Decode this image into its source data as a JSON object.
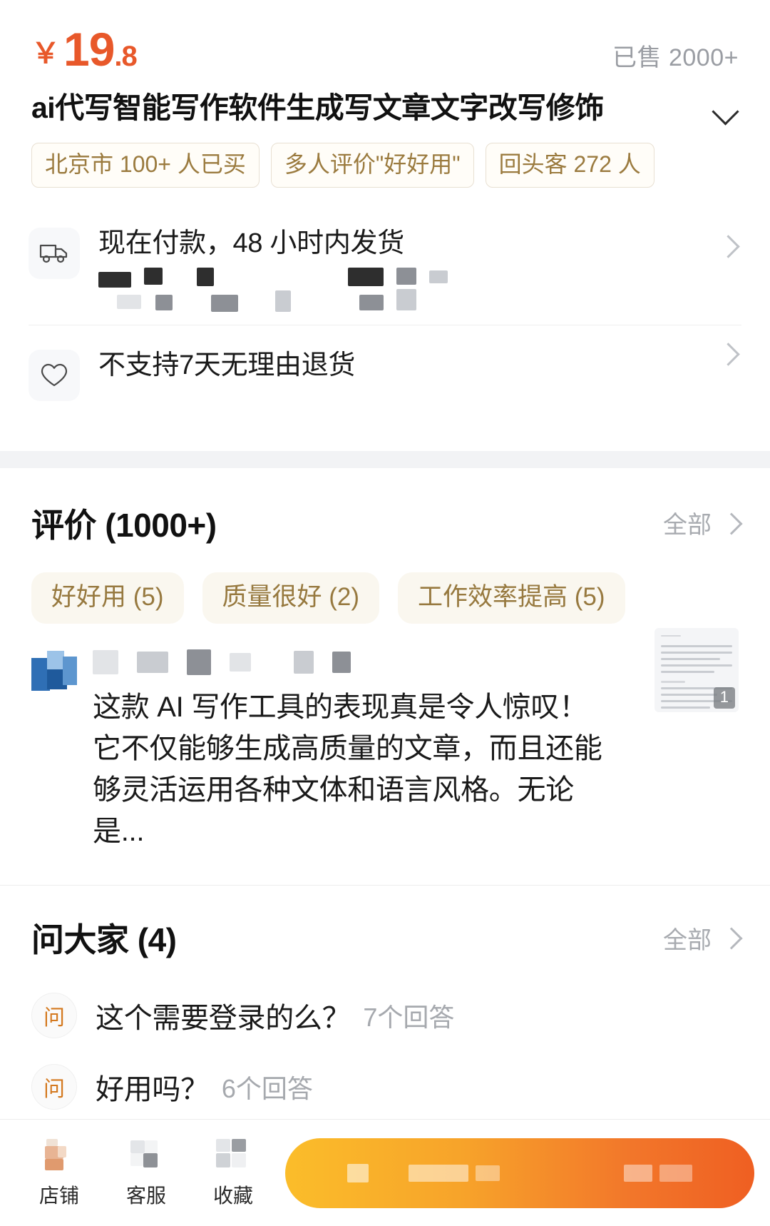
{
  "price": {
    "currency_symbol": "￥",
    "integer": "19",
    "decimal": ".8",
    "sold_label": "已售 2000+"
  },
  "product": {
    "title": "ai代写智能写作软件生成写文章文字改写修饰",
    "expand_icon": "chevron-down-icon",
    "tags": [
      "北京市 100+ 人已买",
      "多人评价\"好好用\"",
      "回头客 272 人"
    ]
  },
  "services": [
    {
      "icon": "truck-icon",
      "title": "现在付款，48 小时内发货",
      "has_redacted_sub": true,
      "chevron": "chevron-right-icon"
    },
    {
      "icon": "heart-icon",
      "title": "不支持7天无理由退货",
      "has_redacted_sub": false,
      "chevron": "chevron-right-icon"
    }
  ],
  "reviews_section": {
    "title": "评价 (1000+)",
    "more_label": "全部",
    "more_icon": "chevron-right-icon",
    "chips": [
      "好好用 (5)",
      "质量很好 (2)",
      "工作效率提高 (5)"
    ],
    "review": {
      "avatar": "user-avatar",
      "name_redacted": true,
      "text": "这款 AI 写作工具的表现真是令人惊叹！它不仅能够生成高质量的文章，而且还能够灵活运用各种文体和语言风格。无论是...",
      "thumbnail_badge": "1"
    }
  },
  "qa_section": {
    "title": "问大家 (4)",
    "more_label": "全部",
    "more_icon": "chevron-right-icon",
    "badge_char": "问",
    "items": [
      {
        "question": "这个需要登录的么？",
        "answers": "7个回答"
      },
      {
        "question": "好用吗？",
        "answers": "6个回答"
      }
    ]
  },
  "bottom_bar": {
    "items": [
      {
        "icon": "shop-icon",
        "label": "店铺"
      },
      {
        "icon": "headset-icon",
        "label": "客服"
      },
      {
        "icon": "star-icon",
        "label": "收藏"
      }
    ],
    "action_button": {
      "label_redacted": true,
      "gradient_start": "#fbbd2a",
      "gradient_end": "#ef5f22"
    }
  },
  "colors": {
    "price_orange": "#e8582a",
    "tag_gold": "#9b7b3f",
    "chip_bg": "#faf7ef",
    "muted_gray": "#a8abb0",
    "band_gray": "#f2f3f5"
  }
}
